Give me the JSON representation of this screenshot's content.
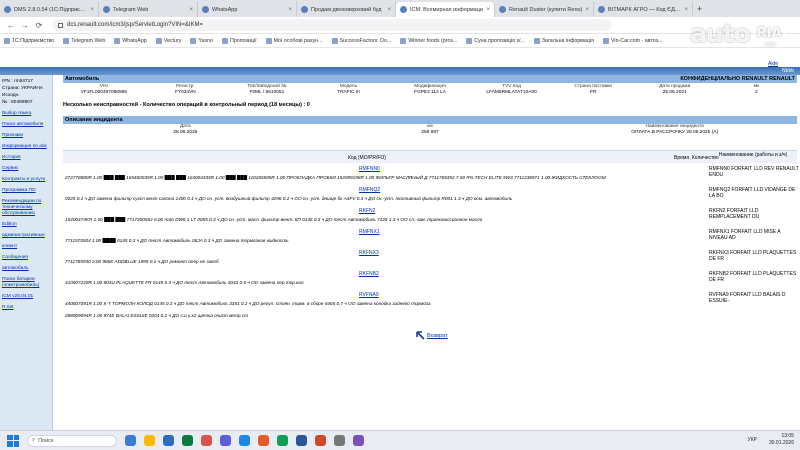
{
  "browser": {
    "tabs": [
      {
        "title": "DMS 2.8.0.54 (1С:Підприємство)",
        "active": false
      },
      {
        "title": "Telegram Web",
        "active": false
      },
      {
        "title": "WhatsApp",
        "active": false
      },
      {
        "title": "Продам двоховерховий буд",
        "active": false
      },
      {
        "title": "ICM: Всемирная информаци",
        "active": true
      },
      {
        "title": "Renault Duster (купити Reno)",
        "active": false
      },
      {
        "title": "ВІТМАРК АГРО — Код ЄДРПОУ",
        "active": false
      }
    ],
    "url": "dcs.renault.com/icm3/jsp/ServletLogin?VIN=&IKM=",
    "bookmarks": [
      "1С:Підприємство",
      "Telegram Web",
      "WhatsApp",
      "Vectury",
      "Yasno",
      "Пропозиції",
      "Мої особові рахун...",
      "SuccessFactors: Do...",
      "Winner foods (ргоз...",
      "Суна пропозиція з/...",
      "Загальна інформація",
      "Vin-Car.com - автоз..."
    ]
  },
  "watermark": {
    "auto": "auto",
    "ria": "RIA",
    "com": ".com"
  },
  "page": {
    "top_link": "Аide",
    "header_links": "Nbbb"
  },
  "sidebar": {
    "info": [
      "IPN : rm94717",
      "Страна: УКРАИНА",
      "Исходн.",
      "№ : 80488907"
    ],
    "links": [
      "Выбор языка",
      "Поиск автомобиля",
      "Признаки",
      "Информация по а/м",
      "История",
      "Сервис",
      "Контракты и услуги",
      "Программа ПО",
      "Рекомендации по техническому обслуживанию",
      "Edition",
      "административные",
      "клиент",
      "Сообщения",
      "автомобиль",
      "Поиск батареи (электромобиль)",
      "ICM v25.04.01",
      "R.net"
    ]
  },
  "vehicle": {
    "section_title": "Автомобиль",
    "confidential": "КОНФИДЕНЦИАЛЬНО RENAULT RENAULT",
    "columns": [
      "VIN",
      "Регистр.",
      "Тип/Заводской №",
      "Модель",
      "Модификация",
      "TVV Код",
      "Страна поставки",
      "Дата продажи",
      "км"
    ],
    "values": [
      "VF1FL000467088969",
      "FY034VN",
      "F0ML / 5610051",
      "TRAFIC III",
      "FGPE2 112 LA",
      "LFAM5RMLATAT10A00",
      "FR",
      "25.06.2021",
      "2"
    ]
  },
  "ops_summary": "Несколько неисправностей - Количество операций в контрольный период (18 месяцы) : 0",
  "incident": {
    "section_title": "Описание инцидента",
    "columns": [
      "Дата",
      "км",
      "Наименование инцидента"
    ],
    "values": [
      "28.06.2025",
      "258 887",
      "ОПЛАТА В РАССРОЧКУ 28.06.2025 (A)"
    ]
  },
  "operations": {
    "headers": {
      "code": "Код (MO/PR/FO)",
      "time": "Время",
      "qty": "Количество",
      "name": "Наименование (работы и з/ч)"
    },
    "rows": [
      {
        "code": "RMFNN0",
        "label": "RMFNN0 FORFAIT LLD REV RENAULT ENDU",
        "desc": "272778880R  1.00  ███.███  165460035R  1.00  ███.███  164004335R  1.00  ███.███  110265505R  1.00  ПРОКЛАДКА ПРОБКИ  152099198R  1.00  ФИЛЬТР МАСЛЯНЫЙ Д  7711785392  7.50  RN-TECH ELITE 5W3  7711238971  1.00  ЖИДКОСТЬ СТЕКЛООМ"
      },
      {
        "code": "RMFNQ2",
        "label": "RMFNQ2 FORFAIT LLD VIDANGE DE LA BO",
        "desc": "0025 0.1 ч  ДО замена фильтр сухсп вент салона  1400 0.1 ч  ДО сн.-уст. воздушный фильтр  4296 0.2 ч  ОО сн.-уст. днище бк  A4FV 0.3 ч  ДО сн.-уст. топливный фильтр  R001 1.3 ч  ДО осм. автомобиль"
      },
      {
        "code": "RKFN2",
        "label": "RKFN2 FORFAIT LLD REMPLACEMENT DU",
        "desc": "15200474KR  1.00  ███.███  7717300552  6.00  Auto DW6 1 LT  00К5 0.3 ч  ДО сн.-уст. масл. фильтр вент. КП  0145 0.3 ч  ДО тест Автомобиль  7225 1.3 ч  ОО сл.-зам. трансмиссионное масло"
      },
      {
        "code": "RMFNX1",
        "label": "RMFNX1 FORFAIT LLD MISE A NIVEAU AD",
        "desc": "7711575504  1.00  ████  0145 0.3 ч  ДО тест Автомобиль  06JA 0.3 ч  ДО замена тормозная жидкость"
      },
      {
        "code": "RKFNX3",
        "label": "RKFNX3 FORFAIT LLD PLAQUETTES DE FR",
        "desc": "7711785930  2.00  986E ADDBLUE  1999 0.1 ч  ДО ремонт опер не закоб"
      },
      {
        "code": "RKFNB2",
        "label": "RKFNB2 FORFAIT LLD PLAQUETTES DE FR",
        "desc": "410607229R  1.00  803U PLAQUETTE FR  0145 0.3 ч  ДО тест Автомобиль  3043 0.6 ч  ОО замена пер.тор.кол."
      },
      {
        "code": "RVFNA9",
        "label": "RVFNA9 FORFAIT LLD BALAIS D ESSUIE-",
        "desc": "440607091R  1.00  К-Т ТОРМОЗН КОЛОД  0145 0.3 ч  ДО тест Автомобиль  3351 0.2 ч  ДО регул. стоян. торм. в сборе  6465 0.7 ч  ОО замена колодка заднего тормоза"
      }
    ],
    "last_desc": "288909094R  1.00  874E BALAI ESSUIE  0204 0.2 ч  ДО с.и у.х2 щетка очист.ветр.ст"
  },
  "back_link": "Возврат",
  "taskbar": {
    "search": "Поиск",
    "lang": "УКР",
    "time": "13:05",
    "date": "30.01.2026",
    "app_colors": [
      "#3a7bd5",
      "#ffb900",
      "#2a6ec0",
      "#0b7a3e",
      "#d9534f",
      "#5e5ed6",
      "#1d87e4",
      "#e25c2a",
      "#0f9d58",
      "#2b579a",
      "#d24726",
      "#777777",
      "#7b4fb8"
    ]
  }
}
